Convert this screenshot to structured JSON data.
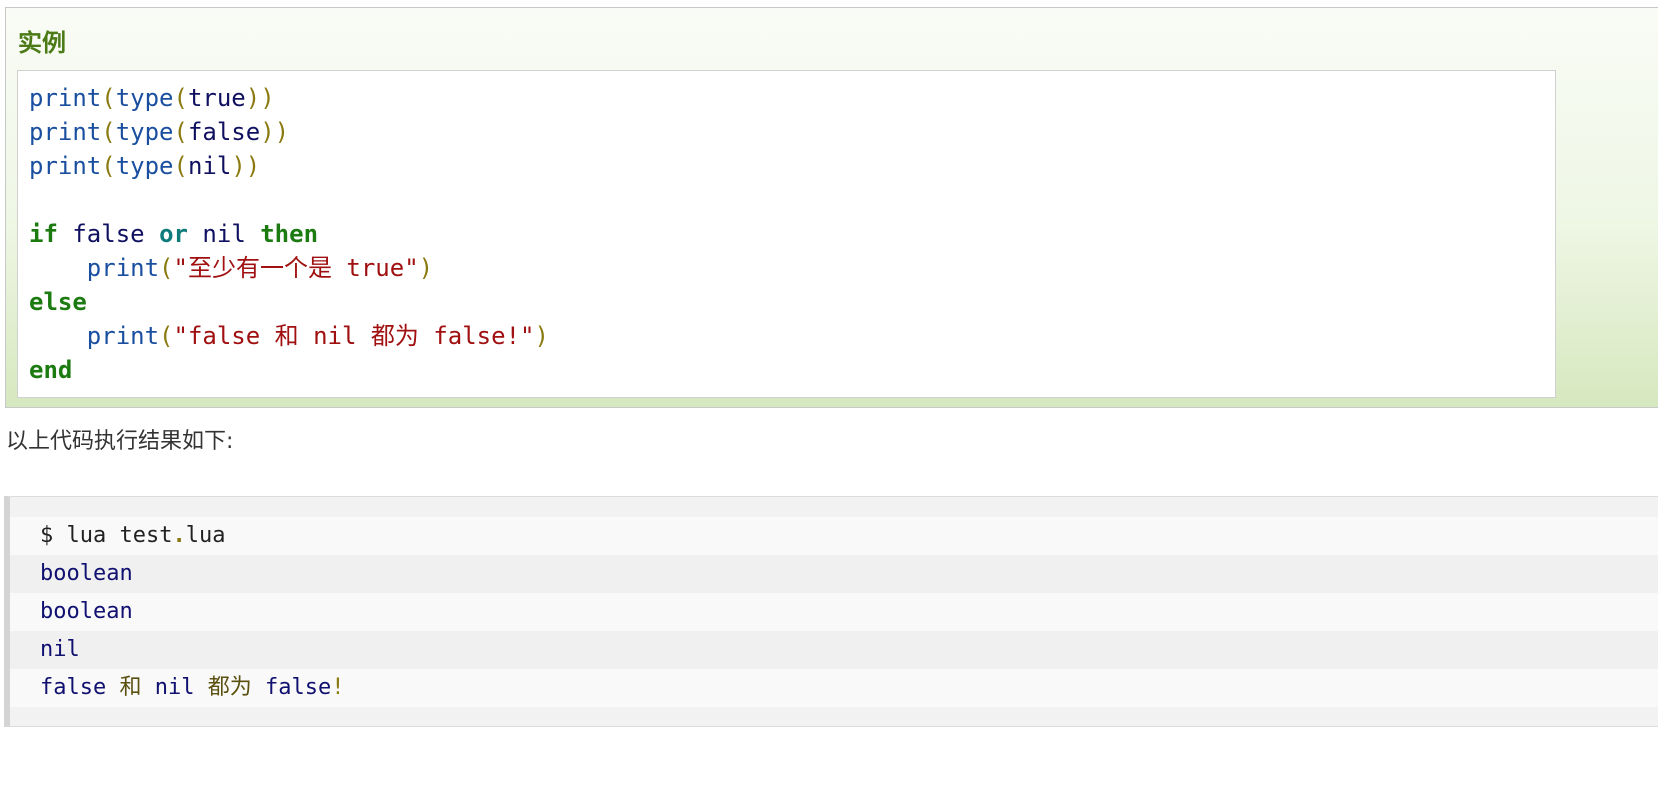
{
  "example": {
    "title": "实例",
    "code": {
      "line1": {
        "fn": "print",
        "open": "(",
        "fn2": "type",
        "open2": "(",
        "arg": "true",
        "close": "))"
      },
      "line2": {
        "fn": "print",
        "open": "(",
        "fn2": "type",
        "open2": "(",
        "arg": "false",
        "close": "))"
      },
      "line3": {
        "fn": "print",
        "open": "(",
        "fn2": "type",
        "open2": "(",
        "arg": "nil",
        "close": "))"
      },
      "line5": {
        "kw_if": "if",
        "v1": " false ",
        "op_or": "or",
        "v2": " nil ",
        "kw_then": "then"
      },
      "line6": {
        "indent": "    ",
        "fn": "print",
        "open": "(",
        "str": "\"至少有一个是 true\"",
        "close": ")"
      },
      "line7": {
        "kw_else": "else"
      },
      "line8": {
        "indent": "    ",
        "fn": "print",
        "open": "(",
        "str": "\"false 和 nil 都为 false!\"",
        "close": ")"
      },
      "line9": {
        "kw_end": "end"
      }
    }
  },
  "result_text": "以上代码执行结果如下:",
  "output": {
    "line1": {
      "prompt": "$ lua test",
      "dot": ".",
      "rest": "lua"
    },
    "line2": "boolean",
    "line3": "boolean",
    "line4": "nil",
    "line5": {
      "w1": "false ",
      "c1": "和",
      "w2": " nil ",
      "c2": "都为",
      "w3": " false",
      "bang": "!"
    }
  },
  "colors": {
    "title_green": "#4b7a17",
    "function_blue": "#1a4fa0",
    "keyword_green": "#1b7a10",
    "string_red": "#a01010",
    "paren_olive": "#8a7a10"
  }
}
